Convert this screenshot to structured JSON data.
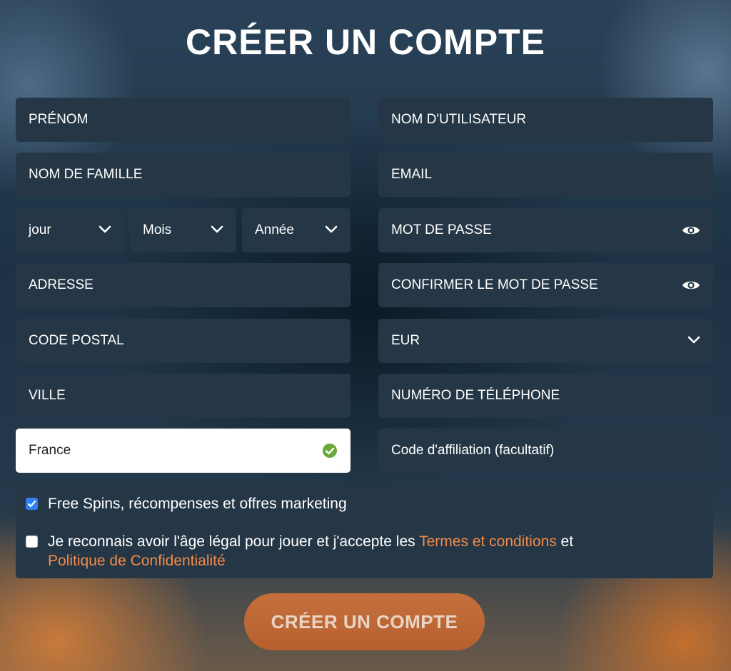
{
  "title": "CRÉER UN COMPTE",
  "left": {
    "first_name": "PRÉNOM",
    "last_name": "NOM DE FAMILLE",
    "day": "jour",
    "month": "Mois",
    "year": "Année",
    "address": "ADRESSE",
    "postal_code": "CODE POSTAL",
    "city": "VILLE",
    "country": "France"
  },
  "right": {
    "username": "NOM D'UTILISATEUR",
    "email": "EMAIL",
    "password": "MOT DE PASSE",
    "confirm_password": "CONFIRMER LE MOT DE PASSE",
    "currency": "EUR",
    "phone": "NUMÉRO DE TÉLÉPHONE",
    "affiliate": "Code d'affiliation (facultatif)"
  },
  "checks": {
    "marketing": "Free Spins, récompenses et offres marketing",
    "marketing_checked": true,
    "terms_prefix": "Je reconnais avoir l'âge légal pour jouer et j'accepte les ",
    "terms_link": "Termes et conditions",
    "terms_middle": " et",
    "privacy_link": "Politique de Confidentialité",
    "terms_checked": false
  },
  "submit_label": "CRÉER UN COMPTE",
  "colors": {
    "field_bg": "#253746",
    "link": "#f28a4a",
    "button": "#c06a36",
    "check": "#2f7ff0",
    "valid": "#6aa83a"
  }
}
